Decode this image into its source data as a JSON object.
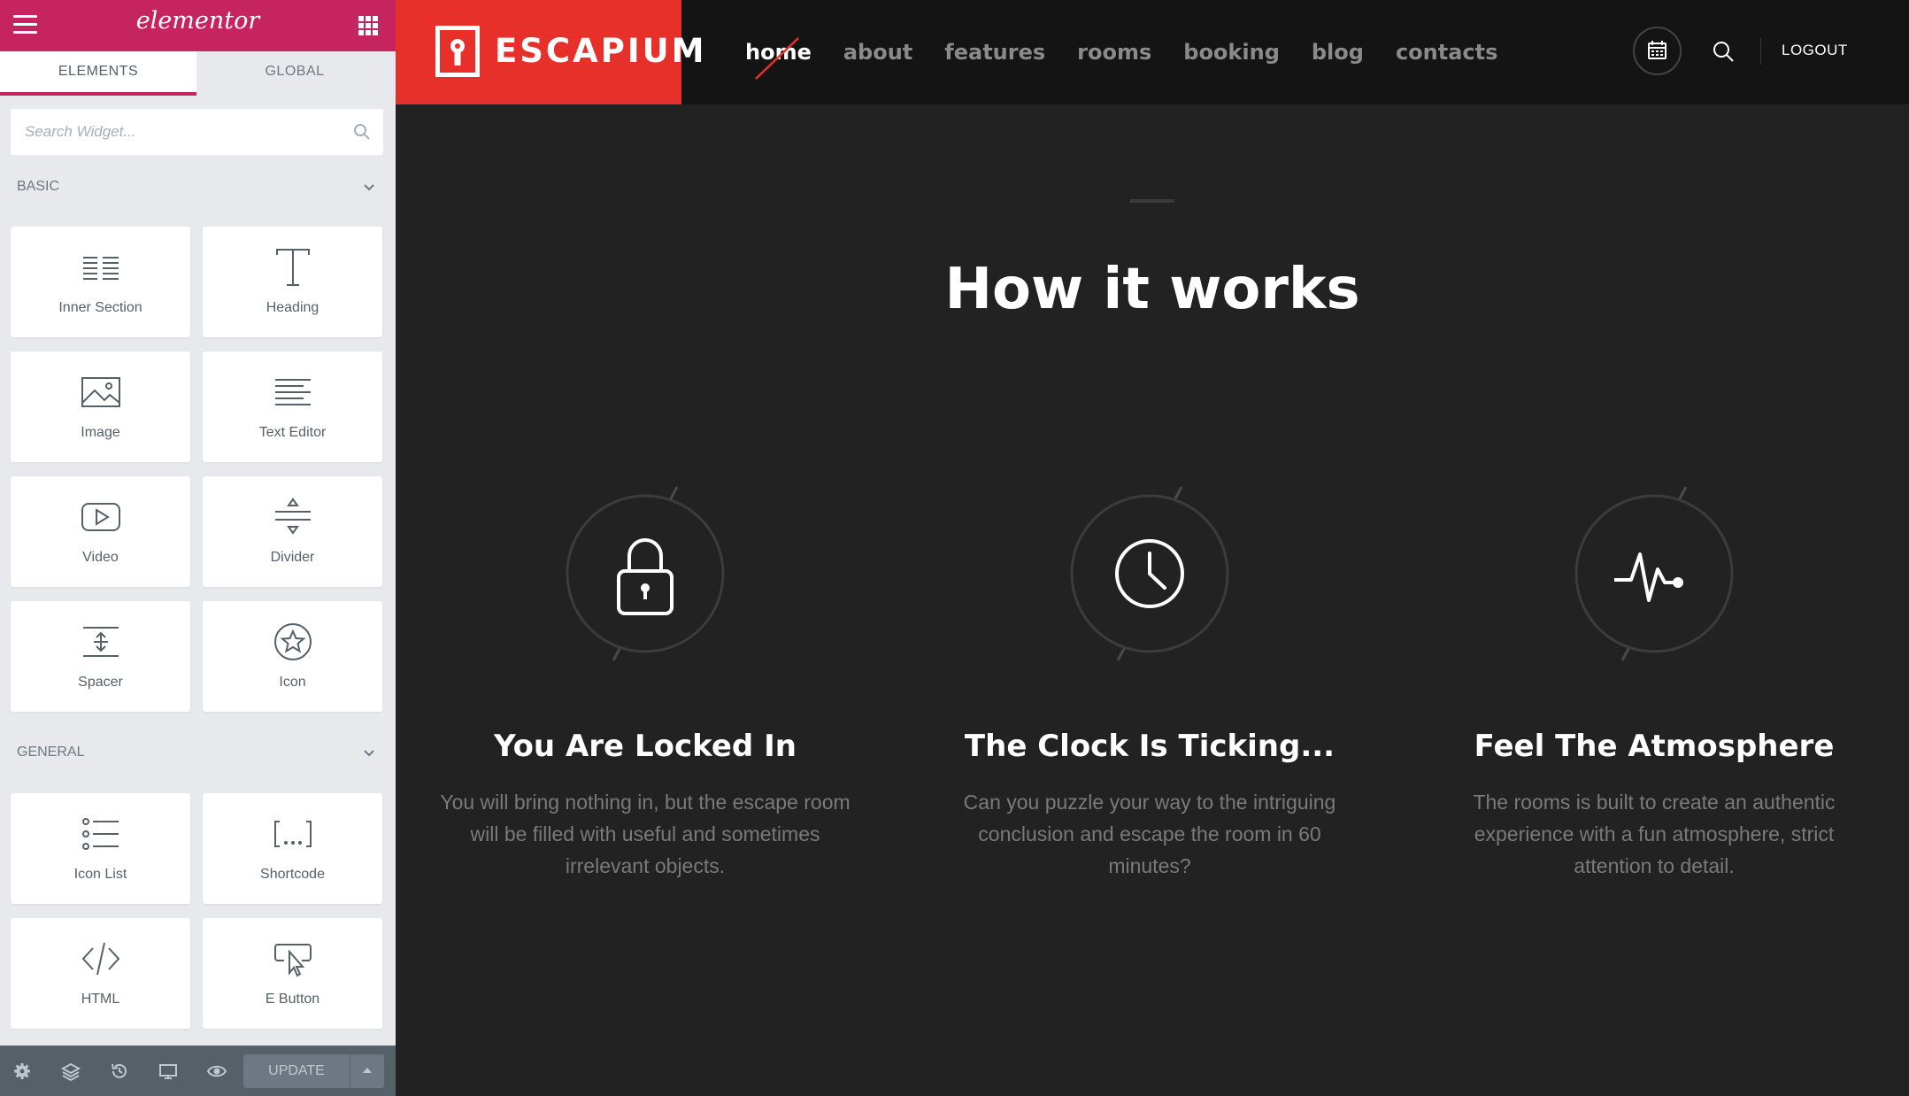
{
  "editor": {
    "logo": "elementor",
    "tabs": [
      "ELEMENTS",
      "GLOBAL"
    ],
    "search_placeholder": "Search Widget...",
    "sections": [
      {
        "label": "BASIC",
        "widgets": [
          "Inner Section",
          "Heading",
          "Image",
          "Text Editor",
          "Video",
          "Divider",
          "Spacer",
          "Icon"
        ]
      },
      {
        "label": "GENERAL",
        "widgets": [
          "Icon List",
          "Shortcode",
          "HTML",
          "E Button"
        ]
      }
    ],
    "update_label": "UPDATE",
    "accent_color": "#c5245e"
  },
  "site": {
    "logo_text": "ESCAPIUM",
    "brand_color": "#e8302a",
    "nav": [
      "home",
      "about",
      "features",
      "rooms",
      "booking",
      "blog",
      "contacts"
    ],
    "active_nav": "home",
    "logout_label": "LOGOUT"
  },
  "section": {
    "title": "How it works",
    "features": [
      {
        "icon": "lock-icon",
        "title": "You Are Locked In",
        "text": "You will bring nothing in, but the escape room will be filled with useful and sometimes irrelevant objects."
      },
      {
        "icon": "clock-icon",
        "title": "The Clock Is Ticking...",
        "text": "Can you puzzle your way to the intriguing conclusion and escape the room in 60 minutes?"
      },
      {
        "icon": "pulse-icon",
        "title": "Feel The Atmosphere",
        "text": "The rooms is built to create an authentic experience with a fun atmosphere, strict attention to detail."
      }
    ]
  }
}
